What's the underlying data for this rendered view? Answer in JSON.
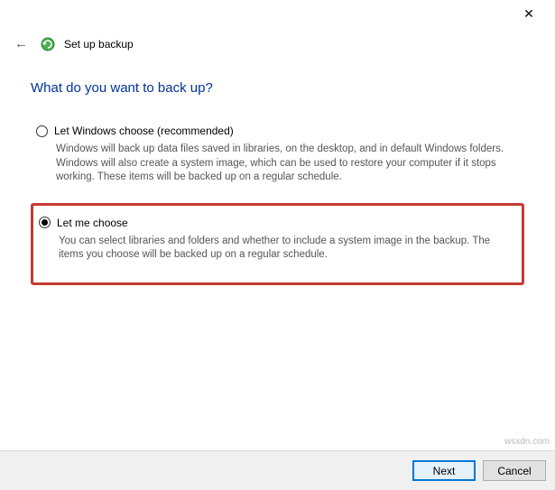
{
  "window": {
    "title": "Set up backup",
    "close_icon": "✕"
  },
  "heading": "What do you want to back up?",
  "options": {
    "windows_choose": {
      "label": "Let Windows choose (recommended)",
      "desc": "Windows will back up data files saved in libraries, on the desktop, and in default Windows folders. Windows will also create a system image, which can be used to restore your computer if it stops working. These items will be backed up on a regular schedule.",
      "selected": false
    },
    "let_me_choose": {
      "label": "Let me choose",
      "desc": "You can select libraries and folders and whether to include a system image in the backup. The items you choose will be backed up on a regular schedule.",
      "selected": true
    }
  },
  "footer": {
    "next_label": "Next",
    "cancel_label": "Cancel"
  },
  "watermark": "wsxdn.com"
}
